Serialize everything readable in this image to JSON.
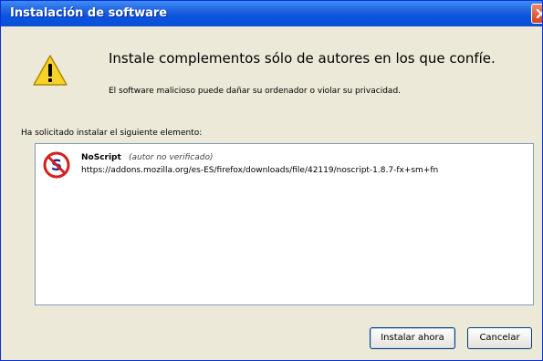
{
  "window": {
    "title": "Instalación de software"
  },
  "warning": {
    "heading": "Instale complementos sólo de autores en los que confíe.",
    "subtext": "El software malicioso puede dañar su ordenador o violar su privacidad."
  },
  "request": {
    "label": "Ha solicitado instalar el siguiente elemento:"
  },
  "addons": [
    {
      "name": "NoScript",
      "author": "(autor no verificado)",
      "url": "https://addons.mozilla.org/es-ES/firefox/downloads/file/42119/noscript-1.8.7-fx+sm+fn"
    }
  ],
  "buttons": {
    "install": "Instalar ahora",
    "cancel": "Cancelar"
  },
  "colors": {
    "titlebar": "#0a54e0",
    "window_bg": "#ece9d8",
    "warning_yellow": "#f5d32a",
    "noscript_red": "#d32020"
  },
  "icons": {
    "warning": "warning-icon",
    "addon": "noscript-icon",
    "close": "close-icon"
  }
}
